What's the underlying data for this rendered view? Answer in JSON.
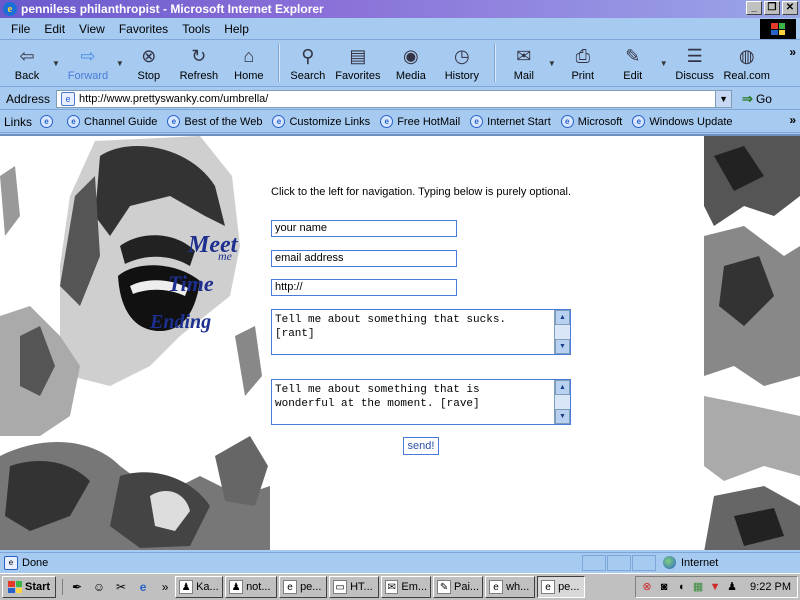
{
  "window": {
    "title": "penniless philanthropist - Microsoft Internet Explorer",
    "controls": [
      "_",
      "❐",
      "✕"
    ]
  },
  "menu": {
    "items": [
      "File",
      "Edit",
      "View",
      "Favorites",
      "Tools",
      "Help"
    ]
  },
  "toolbar": {
    "back": "Back",
    "forward": "Forward",
    "stop": "Stop",
    "refresh": "Refresh",
    "home": "Home",
    "search": "Search",
    "favorites": "Favorites",
    "media": "Media",
    "history": "History",
    "mail": "Mail",
    "print": "Print",
    "edit": "Edit",
    "discuss": "Discuss",
    "realcom": "Real.com"
  },
  "address": {
    "label": "Address",
    "url": "http://www.prettyswanky.com/umbrella/",
    "go": "Go"
  },
  "links": {
    "label": "Links",
    "items": [
      "Channel Guide",
      "Best of the Web",
      "Customize Links",
      "Free HotMail",
      "Internet Start",
      "Microsoft",
      "Windows Update"
    ]
  },
  "page": {
    "logo_words": [
      "Meet",
      "me",
      "Time",
      "Ending"
    ],
    "instructions": "Click to the left for navigation. Typing below is purely optional.",
    "name_value": "your name",
    "email_value": "email address",
    "url_value": "http://",
    "rant_text": "Tell me about something that sucks.\n[rant]",
    "rave_text": "Tell me about something that is\nwonderful at the moment. [rave]",
    "send_label": "send!"
  },
  "status": {
    "text": "Done",
    "zone": "Internet"
  },
  "taskbar": {
    "start": "Start",
    "tasks": [
      "Ka...",
      "not...",
      "pe...",
      "HT...",
      "Em...",
      "Pai...",
      "wh...",
      "pe..."
    ],
    "clock": "9:22 PM"
  },
  "colors": {
    "chrome": "#a6caf0",
    "title_start": "#6a5acd",
    "logo_blue": "#1d2f8f"
  }
}
